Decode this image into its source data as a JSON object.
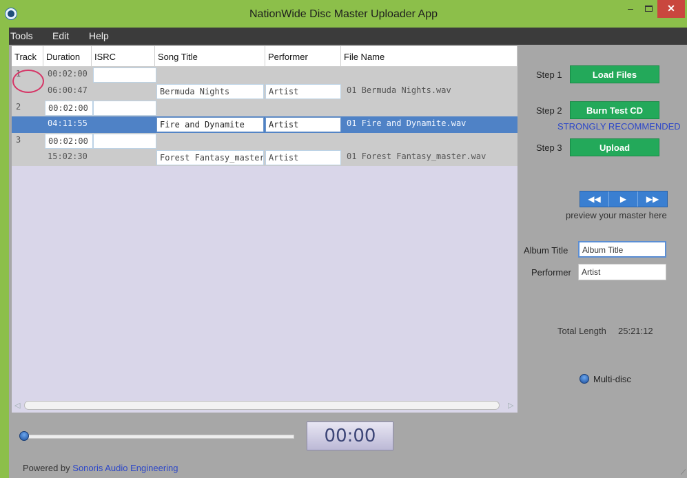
{
  "window": {
    "title": "NationWide Disc Master Uploader App",
    "minimize": "–",
    "close": "✕"
  },
  "menu": [
    "Tools",
    "Edit",
    "Help"
  ],
  "table": {
    "columns": [
      "Track",
      "Duration",
      "ISRC",
      "Song Title",
      "Performer",
      "File Name"
    ],
    "rows": [
      {
        "track": "1",
        "duration": "00:02:00",
        "isrc": "",
        "title": "",
        "performer": "",
        "file": "",
        "kind": "pregap"
      },
      {
        "track": "",
        "duration": "06:00:47",
        "isrc": "",
        "title": "Bermuda Nights",
        "performer": "Artist",
        "file": "01 Bermuda Nights.wav",
        "kind": "song"
      },
      {
        "track": "2",
        "duration": "00:02:00",
        "isrc": "",
        "title": "",
        "performer": "",
        "file": "",
        "kind": "pregap"
      },
      {
        "track": "",
        "duration": "04:11:55",
        "isrc": "",
        "title": "Fire and Dynamite",
        "performer": "Artist",
        "file": "01 Fire and Dynamite.wav",
        "kind": "song",
        "selected": true
      },
      {
        "track": "3",
        "duration": "00:02:00",
        "isrc": "",
        "title": "",
        "performer": "",
        "file": "",
        "kind": "pregap"
      },
      {
        "track": "",
        "duration": "15:02:30",
        "isrc": "",
        "title": "Forest Fantasy_master",
        "performer": "Artist",
        "file": "01 Forest Fantasy_master.wav",
        "kind": "song"
      }
    ]
  },
  "steps": [
    {
      "label": "Step 1",
      "button": "Load Files"
    },
    {
      "label": "Step 2",
      "button": "Burn Test CD",
      "note": "STRONGLY RECOMMENDED"
    },
    {
      "label": "Step 3",
      "button": "Upload"
    }
  ],
  "player": {
    "rewind": "◀◀",
    "play": "▶",
    "forward": "▶▶",
    "caption": "preview your master here",
    "time": "00:00"
  },
  "album": {
    "title_label": "Album Title",
    "title_value": "Album Title",
    "performer_label": "Performer",
    "performer_value": "Artist"
  },
  "total": {
    "label": "Total Length",
    "value": "25:21:12"
  },
  "multidisc": {
    "label": "Multi-disc"
  },
  "footer": {
    "prefix": "Powered by",
    "link": "Sonoris Audio Engineering"
  },
  "colors": {
    "accent_green": "#23a95a",
    "selection": "#4f82c6",
    "link_blue": "#2b46c8"
  }
}
